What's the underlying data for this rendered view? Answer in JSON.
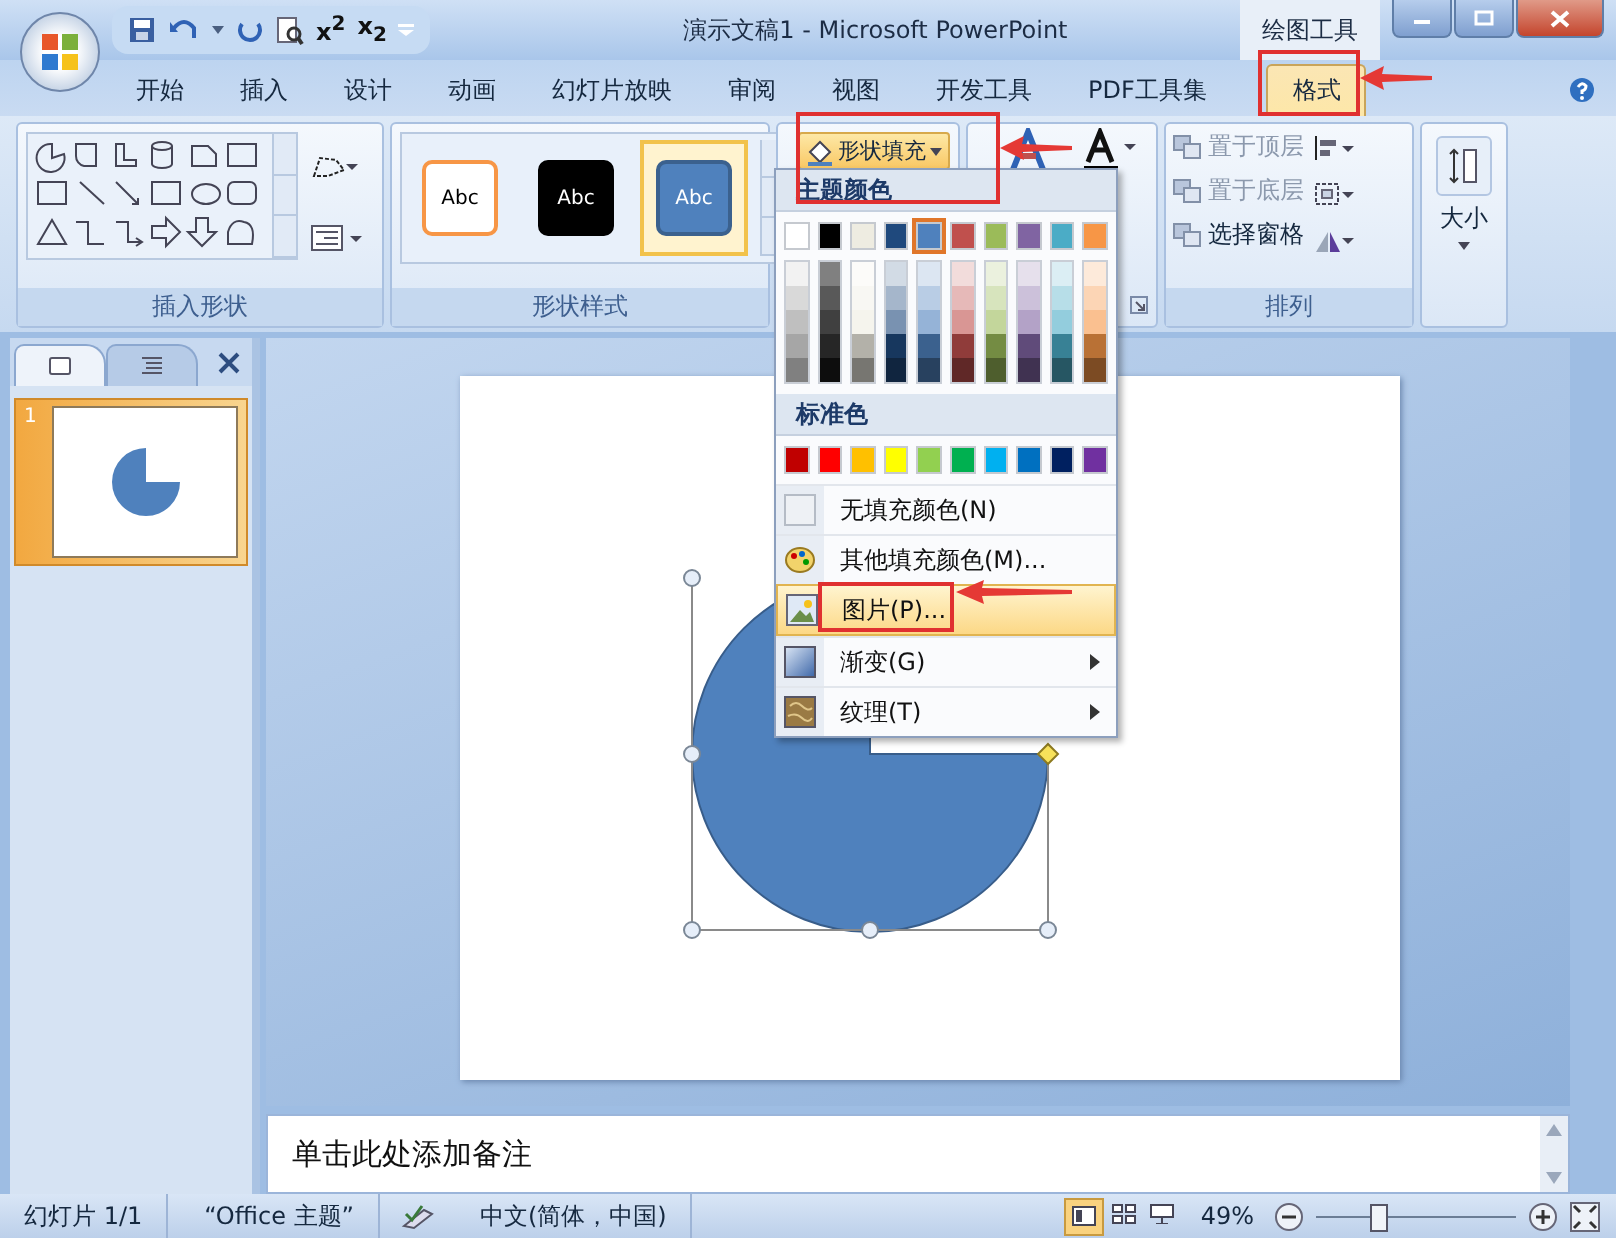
{
  "window": {
    "title": "演示文稿1 - Microsoft PowerPoint",
    "context_label": "绘图工具"
  },
  "quick_access": [
    "x$^{2}$",
    "x$_{2}$"
  ],
  "tabs": [
    {
      "label": "开始",
      "selected": false
    },
    {
      "label": "插入",
      "selected": false
    },
    {
      "label": "设计",
      "selected": false
    },
    {
      "label": "动画",
      "selected": false
    },
    {
      "label": "幻灯片放映",
      "selected": false
    },
    {
      "label": "审阅",
      "selected": false
    },
    {
      "label": "视图",
      "selected": false
    },
    {
      "label": "开发工具",
      "selected": false
    },
    {
      "label": "PDF工具集",
      "selected": false
    },
    {
      "label": "格式",
      "selected": true
    }
  ],
  "ribbon": {
    "shapes_group": "插入形状",
    "styles_group": {
      "label": "形状样式",
      "styles": [
        {
          "text": "Abc",
          "kind": "outline",
          "color": "#f79646",
          "selected": false
        },
        {
          "text": "Abc",
          "kind": "solid",
          "color": "#000000",
          "selected": false
        },
        {
          "text": "Abc",
          "kind": "solid",
          "color": "#4f81bd",
          "selected": true
        }
      ]
    },
    "fill_button": "形状填充",
    "arrange_group": {
      "label": "排列",
      "items": [
        "置于顶层",
        "置于底层",
        "选择窗格"
      ]
    },
    "size_button": "大小"
  },
  "fill_menu": {
    "theme_heading": "主题颜色",
    "theme_colors": [
      {
        "color": "#ffffff",
        "selected": false
      },
      {
        "color": "#000000",
        "selected": false
      },
      {
        "color": "#eeece1",
        "selected": false
      },
      {
        "color": "#1f497d",
        "selected": false
      },
      {
        "color": "#4f81bd",
        "selected": true
      },
      {
        "color": "#c0504d",
        "selected": false
      },
      {
        "color": "#9bbb59",
        "selected": false
      },
      {
        "color": "#8064a2",
        "selected": false
      },
      {
        "color": "#4bacc6",
        "selected": false
      },
      {
        "color": "#f79646",
        "selected": false
      }
    ],
    "standard_heading": "标准色",
    "standard_colors": [
      {
        "color": "#c00000"
      },
      {
        "color": "#ff0000"
      },
      {
        "color": "#ffc000"
      },
      {
        "color": "#ffff00"
      },
      {
        "color": "#92d050"
      },
      {
        "color": "#00b050"
      },
      {
        "color": "#00b0f0"
      },
      {
        "color": "#0070c0"
      },
      {
        "color": "#002060"
      },
      {
        "color": "#7030a0"
      }
    ],
    "items": [
      {
        "kind": "no-fill",
        "label": "无填充颜色(N)",
        "highlighted": false,
        "submenu": false
      },
      {
        "kind": "more-colors",
        "label": "其他填充颜色(M)...",
        "highlighted": false,
        "submenu": false
      },
      {
        "kind": "picture",
        "label": "图片(P)...",
        "highlighted": true,
        "submenu": false
      },
      {
        "kind": "gradient",
        "label": "渐变(G)",
        "highlighted": false,
        "submenu": true
      },
      {
        "kind": "texture",
        "label": "纹理(T)",
        "highlighted": false,
        "submenu": true
      }
    ]
  },
  "slides_pane": {
    "tabs": [
      {
        "kind": "slides",
        "selected": true
      },
      {
        "kind": "outline",
        "selected": false
      }
    ],
    "thumbnails": [
      {
        "number": "1",
        "selected": true
      }
    ]
  },
  "notes": {
    "prompt": "单击此处添加备注"
  },
  "status_bar": {
    "slide": "幻灯片 1/1",
    "theme": "“Office 主题”",
    "language": "中文(简体，中国)",
    "views": [
      {
        "kind": "normal",
        "selected": true
      },
      {
        "kind": "sorter",
        "selected": false
      },
      {
        "kind": "show",
        "selected": false
      }
    ],
    "zoom": "49%",
    "zoom_slider": {
      "level": 0.3
    }
  }
}
